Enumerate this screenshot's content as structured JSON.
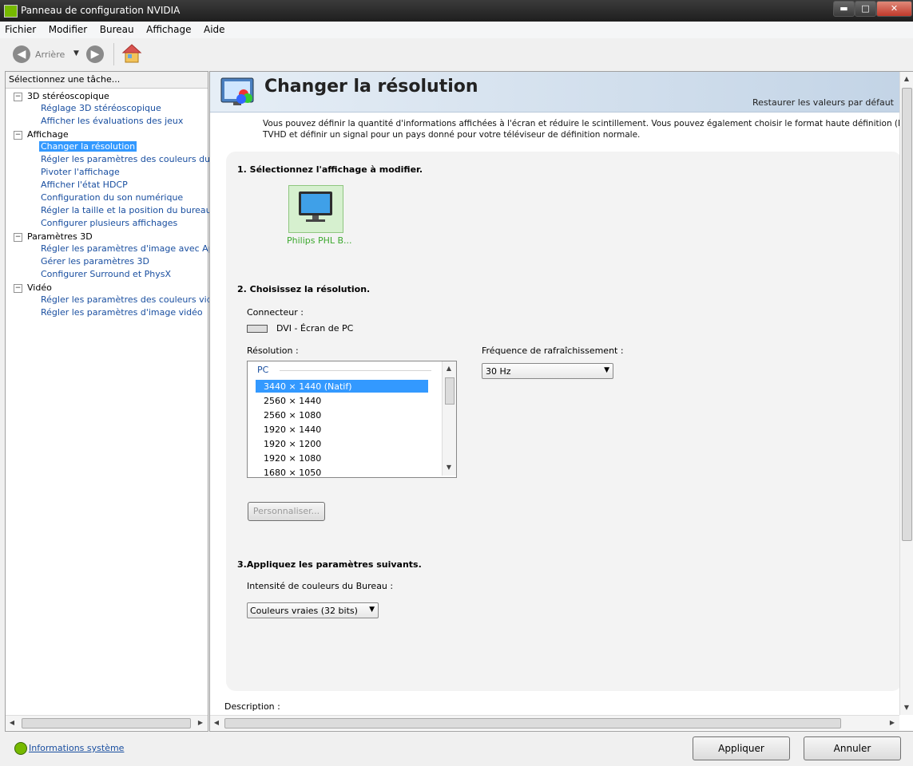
{
  "window": {
    "title": "Panneau de configuration NVIDIA",
    "minimize": "▬",
    "maximize": "□",
    "close": "✕"
  },
  "menu": {
    "items": [
      "Fichier",
      "Modifier",
      "Bureau",
      "Affichage",
      "Aide"
    ]
  },
  "toolbar": {
    "back_label": "Arrière"
  },
  "tree": {
    "header": "Sélectionnez une tâche...",
    "categories": [
      {
        "label": "3D stéréoscopique",
        "items": [
          "Réglage 3D stéréoscopique",
          "Afficher les évaluations des jeux"
        ]
      },
      {
        "label": "Affichage",
        "items": [
          "Changer la résolution",
          "Régler les paramètres des couleurs du bure",
          "Pivoter l'affichage",
          "Afficher l'état HDCP",
          "Configuration du son numérique",
          "Régler la taille et la position du bureau",
          "Configurer plusieurs affichages"
        ]
      },
      {
        "label": "Paramètres 3D",
        "items": [
          "Régler les paramètres d'image avec Aperçu",
          "Gérer les paramètres 3D",
          "Configurer Surround et PhysX"
        ]
      },
      {
        "label": "Vidéo",
        "items": [
          "Régler les paramètres des couleurs vidéo",
          "Régler les paramètres d'image vidéo"
        ]
      }
    ],
    "selected": "Changer la résolution"
  },
  "page": {
    "title": "Changer la résolution",
    "restore": "Restaurer les valeurs par défaut",
    "intro_line1": "Vous pouvez définir la quantité d'informations affichées à l'écran et réduire le scintillement. Vous pouvez également choisir le format haute définition (HD) si vous utilisez ur",
    "intro_line2": "TVHD et définir un signal pour un pays donné pour votre téléviseur de définition normale.",
    "step1": "1. Sélectionnez l'affichage à modifier.",
    "display_name": "Philips PHL B...",
    "step2": "2. Choisissez la résolution.",
    "connector_label": "Connecteur :",
    "connector_value": "DVI - Écran de PC",
    "resolution_label": "Résolution :",
    "resolution_group": "PC",
    "resolutions": [
      "3440 × 1440 (Natif)",
      "2560 × 1440",
      "2560 × 1080",
      "1920 × 1440",
      "1920 × 1200",
      "1920 × 1080",
      "1680 × 1050"
    ],
    "refresh_label": "Fréquence de rafraîchissement :",
    "refresh_value": "30 Hz",
    "customize_button": "Personnaliser...",
    "step3": "3.Appliquez les paramètres suivants.",
    "color_depth_label": "Intensité de couleurs du Bureau :",
    "color_depth_value": "Couleurs vraies (32 bits)",
    "description_label": "Description :"
  },
  "footer": {
    "system_info": "Informations système",
    "apply": "Appliquer",
    "cancel": "Annuler"
  },
  "colors": {
    "nvidia_green": "#76b900",
    "link_blue": "#1a4fa0",
    "selection": "#3399ff"
  }
}
